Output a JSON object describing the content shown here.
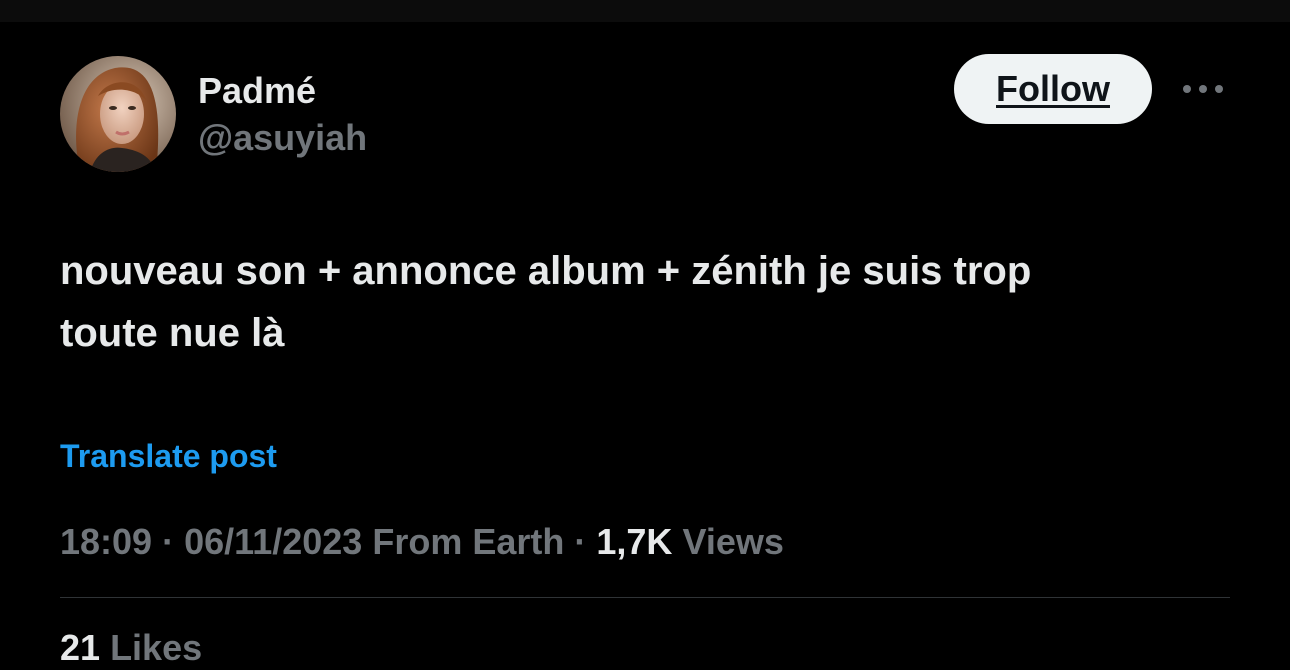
{
  "post": {
    "author": {
      "name": "Padmé",
      "handle": "@asuyiah",
      "avatar_icon": "profile-photo-avatar"
    },
    "follow_label": "Follow",
    "more_icon": "more-options-icon",
    "text_line1": "nouveau son + annonce album + zénith je suis trop",
    "text_line2": "toute nue là",
    "translate_label": "Translate post",
    "time": "18:09",
    "date": "06/11/2023",
    "location": "From Earth",
    "separator": "·",
    "views_count": "1,7K",
    "views_label": "Views",
    "likes_count": "21",
    "likes_label": "Likes"
  },
  "colors": {
    "background": "#000000",
    "primary_text": "#e7e9ea",
    "secondary_text": "#71767b",
    "link": "#1d9bf0",
    "follow_bg": "#eff3f4",
    "divider": "#2f3336"
  }
}
